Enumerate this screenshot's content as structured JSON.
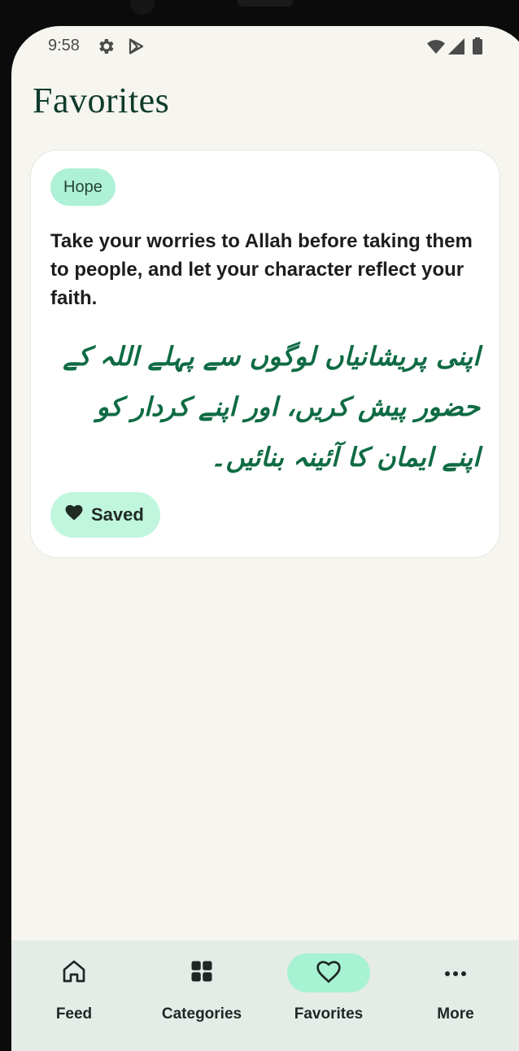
{
  "status_bar": {
    "time": "9:58",
    "icons": [
      "gear-icon",
      "play-store-icon",
      "wifi-icon",
      "signal-icon",
      "battery-icon"
    ]
  },
  "page": {
    "title": "Favorites"
  },
  "favorites": [
    {
      "category": "Hope",
      "quote_en": "Take your worries to Allah before taking them to people, and let your character reflect your faith.",
      "quote_ur": "اپنی پریشانیاں لوگوں سے پہلے اللہ کے حضور پیش کریں، اور اپنے کردار کو اپنے ایمان کا آئینہ بنائیں۔",
      "saved_label": "Saved"
    }
  ],
  "bottom_nav": {
    "items": [
      {
        "label": "Feed",
        "icon": "home-icon",
        "active": false
      },
      {
        "label": "Categories",
        "icon": "grid-icon",
        "active": false
      },
      {
        "label": "Favorites",
        "icon": "heart-icon",
        "active": true
      },
      {
        "label": "More",
        "icon": "more-icon",
        "active": false
      }
    ]
  },
  "colors": {
    "accent": "#a7f2d3",
    "title": "#0f3b2c",
    "urdu_text": "#0f6b44",
    "background": "#f6f5f0"
  }
}
